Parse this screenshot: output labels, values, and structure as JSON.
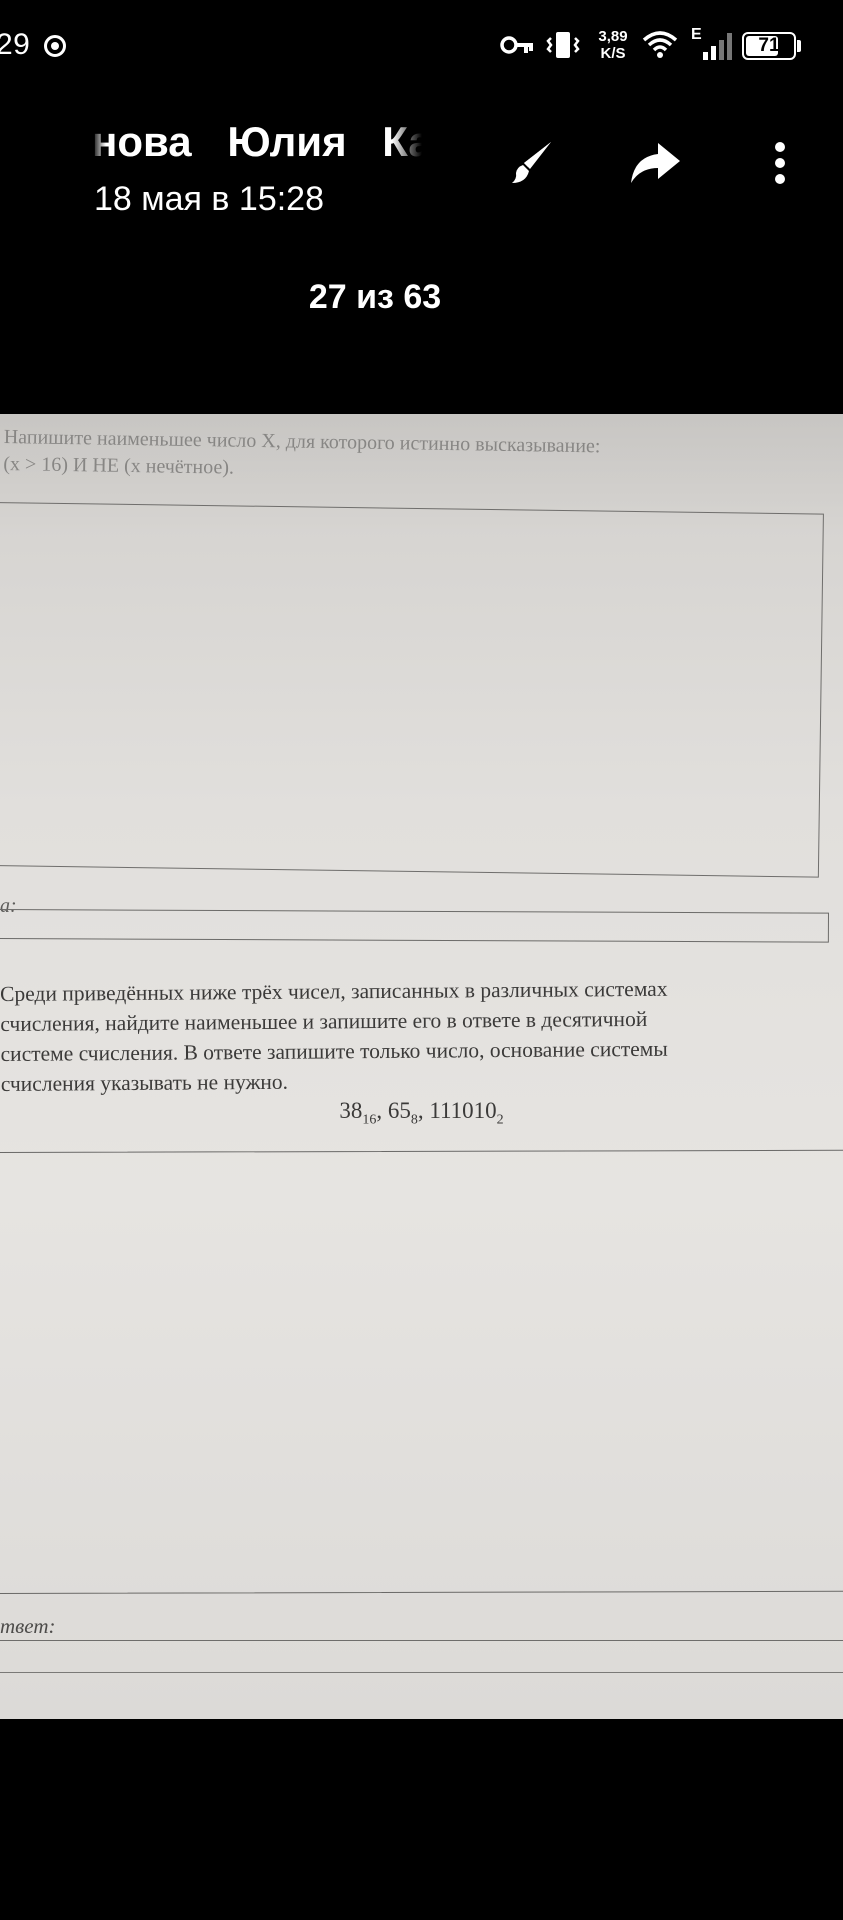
{
  "status_bar": {
    "time": "29",
    "net_speed_value": "3,89",
    "net_speed_unit": "K/S",
    "network_type": "E",
    "battery_level": "71",
    "battery_fraction": 0.71,
    "icons": [
      "record-icon",
      "key-icon",
      "vibrate-icon",
      "wifi-icon",
      "signal-icon",
      "battery-icon"
    ]
  },
  "header": {
    "sender_name": "нова Юлия Ка",
    "date": "18 мая в 15:28",
    "actions": {
      "edit_icon": "brush-icon",
      "share_icon": "share-arrow-icon",
      "more_icon": "more-vertical-icon"
    },
    "counter": "27 из 63"
  },
  "photo": {
    "task1_line1": "Напишите наименьшее число X, для которого истинно высказывание:",
    "task1_line2": "(x > 16) И НЕ (x нечётное).",
    "answer1_label": "а:",
    "task2_lines": [
      "Среди приведённых ниже трёх чисел, записанных в различных системах",
      "счисления, найдите наименьшее и запишите его в ответе в десятичной",
      "системе счисления. В ответе запишите только число, основание системы",
      "счисления указывать не нужно."
    ],
    "numbers": [
      {
        "value": "38",
        "base": "16",
        "sep": ", "
      },
      {
        "value": "65",
        "base": "8",
        "sep": ", "
      },
      {
        "value": "111010",
        "base": "2",
        "sep": ""
      }
    ],
    "answer2_label": "твет:"
  }
}
